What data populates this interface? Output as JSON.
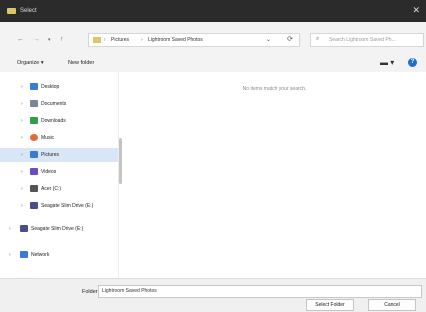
{
  "window": {
    "title": "Select"
  },
  "nav": {
    "breadcrumb": [
      "Pictures",
      "Lightroom Saved Photos"
    ],
    "search_placeholder": "Search Lightroom Saved Ph..."
  },
  "toolbar": {
    "organize": "Organize ▾",
    "new_folder": "New folder"
  },
  "sidebar": {
    "items": [
      {
        "label": "Desktop",
        "icon": "desktop-icon",
        "color": "#3a7bd5"
      },
      {
        "label": "Documents",
        "icon": "documents-icon",
        "color": "#7a8796"
      },
      {
        "label": "Downloads",
        "icon": "downloads-icon",
        "color": "#2f9e44"
      },
      {
        "label": "Music",
        "icon": "music-icon",
        "color": "#e06a3a"
      },
      {
        "label": "Pictures",
        "icon": "pictures-icon",
        "color": "#3a7bd5",
        "selected": true
      },
      {
        "label": "Videos",
        "icon": "videos-icon",
        "color": "#6a4bc4"
      },
      {
        "label": "Acer (C:)",
        "icon": "drive-icon",
        "color": "#555555"
      },
      {
        "label": "Seagate Slim Drive (E:)",
        "icon": "external-drive-icon",
        "color": "#4b4e8a"
      },
      {
        "label": "Seagate Slim Drive (E:)",
        "icon": "external-drive-icon",
        "color": "#4b4e8a"
      },
      {
        "label": "Network",
        "icon": "network-icon",
        "color": "#3a7bd5"
      }
    ]
  },
  "main": {
    "empty_text": "No items match your search."
  },
  "footer": {
    "folder_label": "Folder:",
    "folder_value": "Lightroom Saved Photos",
    "select_button": "Select Folder",
    "cancel_button": "Cancel"
  }
}
